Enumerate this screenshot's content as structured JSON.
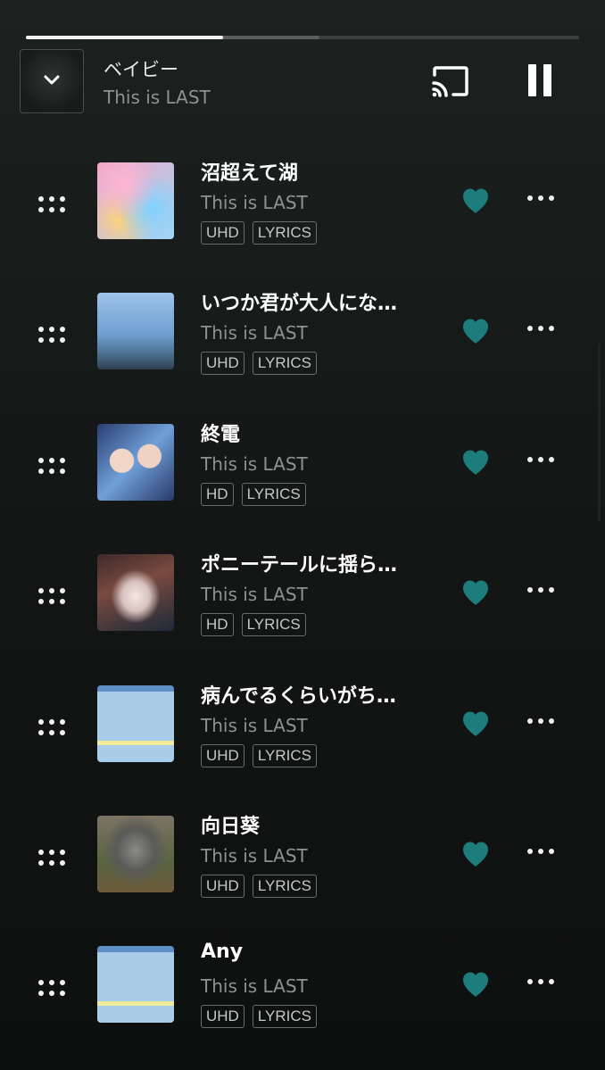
{
  "player": {
    "now_playing": {
      "title": "ベイビー",
      "artist": "This is LAST"
    },
    "progress": {
      "played_fraction": 0.357,
      "buffered_fraction": 0.531
    },
    "icons": {
      "collapse": "chevron-down-icon",
      "cast": "cast-icon",
      "pause": "pause-icon"
    },
    "accent_color": "#1d7c7c"
  },
  "tracks": [
    {
      "title": "沼超えて湖",
      "artist": "This is LAST",
      "quality": "UHD",
      "lyrics": "LYRICS",
      "favorited": true
    },
    {
      "title": "いつか君が大人にな…",
      "artist": "This is LAST",
      "quality": "UHD",
      "lyrics": "LYRICS",
      "favorited": true
    },
    {
      "title": "終電",
      "artist": "This is LAST",
      "quality": "HD",
      "lyrics": "LYRICS",
      "favorited": true
    },
    {
      "title": "ポニーテールに揺ら…",
      "artist": "This is LAST",
      "quality": "HD",
      "lyrics": "LYRICS",
      "favorited": true
    },
    {
      "title": "病んでるくらいがち…",
      "artist": "This is LAST",
      "quality": "UHD",
      "lyrics": "LYRICS",
      "favorited": true
    },
    {
      "title": "向日葵",
      "artist": "This is LAST",
      "quality": "UHD",
      "lyrics": "LYRICS",
      "favorited": true
    },
    {
      "title": "Any",
      "artist": "This is LAST",
      "quality": "UHD",
      "lyrics": "LYRICS",
      "favorited": true
    }
  ]
}
